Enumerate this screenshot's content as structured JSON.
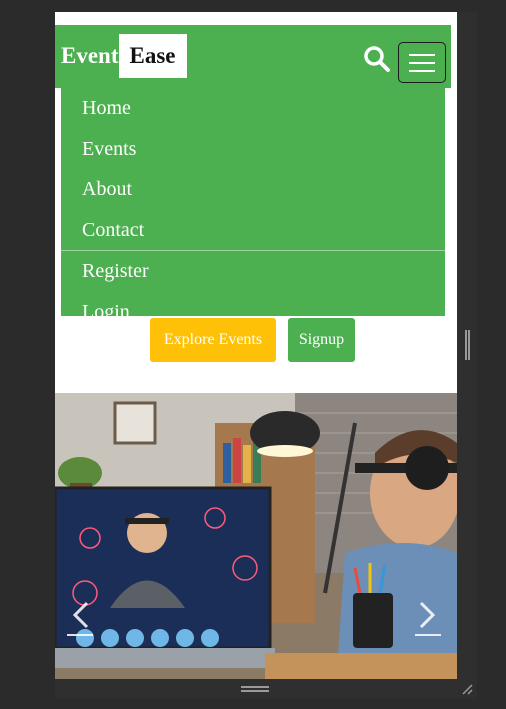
{
  "brand": {
    "part1": "Event",
    "part2": "Ease"
  },
  "nav": {
    "items": [
      {
        "label": "Home"
      },
      {
        "label": "Events"
      },
      {
        "label": "About"
      },
      {
        "label": "Contact"
      },
      {
        "label": "Register"
      },
      {
        "label": "Login"
      }
    ]
  },
  "hero": {
    "explore_label": "Explore Events",
    "signup_label": "Signup"
  },
  "colors": {
    "primary": "#4caf50",
    "accent": "#ffc107",
    "frame": "#2b2b2b"
  },
  "icons": [
    "search-icon",
    "hamburger-menu-icon",
    "chevron-left-icon",
    "chevron-right-icon"
  ]
}
